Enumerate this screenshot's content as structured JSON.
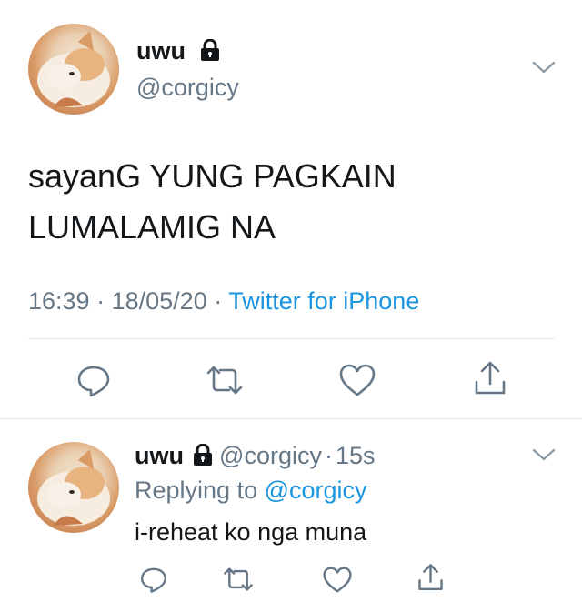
{
  "main_tweet": {
    "display_name": "uwu",
    "handle": "@corgicy",
    "text_line1": "sayanG YUNG PAGKAIN",
    "text_line2": "LUMALAMIG NA",
    "time": "16:39",
    "date": "18/05/20",
    "source": "Twitter for iPhone",
    "separator": "·"
  },
  "reply_tweet": {
    "display_name": "uwu",
    "handle": "@corgicy",
    "separator": "·",
    "age": "15s",
    "replying_prefix": "Replying to",
    "replying_handle": "@corgicy",
    "text": "i-reheat ko nga muna"
  },
  "icons": {
    "lock": "lock-icon",
    "chevron": "chevron-down-icon",
    "reply": "reply-icon",
    "retweet": "retweet-icon",
    "like": "like-icon",
    "share": "share-icon"
  },
  "colors": {
    "text": "#14171a",
    "secondary": "#657786",
    "link": "#1b95e0",
    "divider": "#e1e8ed"
  }
}
